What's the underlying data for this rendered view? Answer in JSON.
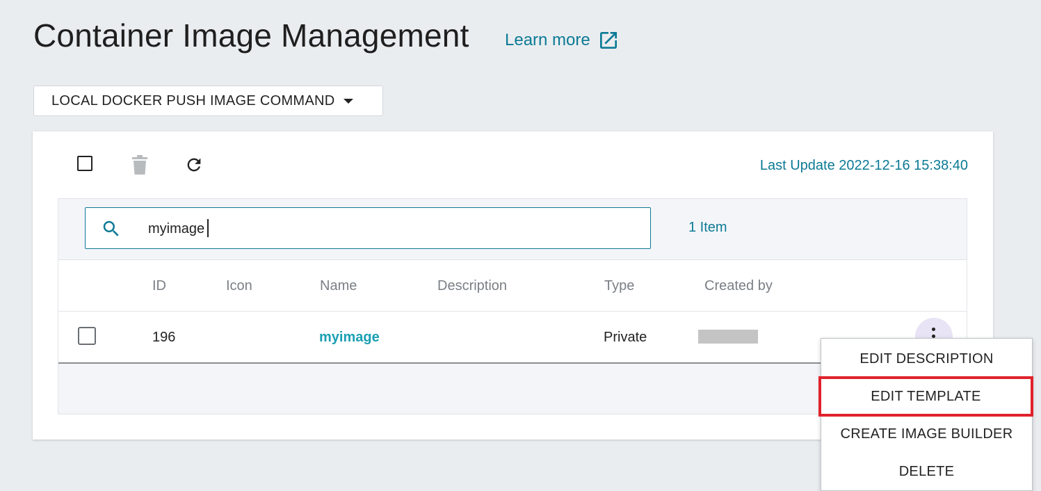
{
  "page": {
    "title": "Container Image Management",
    "learn_more": "Learn more"
  },
  "push_command": {
    "label": "LOCAL DOCKER PUSH IMAGE COMMAND"
  },
  "toolbar": {
    "last_update": "Last Update 2022-12-16 15:38:40"
  },
  "search": {
    "value": "myimage",
    "item_count": "1 Item"
  },
  "table": {
    "columns": [
      "ID",
      "Icon",
      "Name",
      "Description",
      "Type",
      "Created by"
    ],
    "rows": [
      {
        "id": "196",
        "icon": "",
        "name": "myimage",
        "description": "",
        "type": "Private",
        "created_by": ""
      }
    ]
  },
  "context_menu": {
    "items": [
      "EDIT DESCRIPTION",
      "EDIT TEMPLATE",
      "CREATE IMAGE BUILDER",
      "DELETE"
    ],
    "highlighted": "EDIT TEMPLATE",
    "highlight_color": "#e0222c"
  },
  "colors": {
    "accent": "#0b7a95",
    "link": "#1a9fb3",
    "background": "#eaedf0"
  },
  "icons": [
    "external-link-icon",
    "caret-down-icon",
    "checkbox-icon",
    "trash-icon",
    "refresh-icon",
    "search-icon",
    "kebab-menu-icon"
  ]
}
